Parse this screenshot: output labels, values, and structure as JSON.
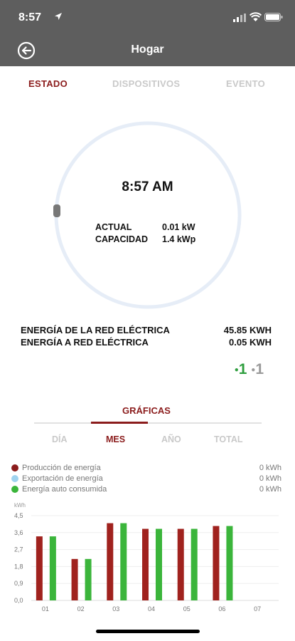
{
  "status_bar": {
    "time": "8:57"
  },
  "header": {
    "title": "Hogar"
  },
  "tabs": [
    {
      "label": "ESTADO",
      "active": true
    },
    {
      "label": "DISPOSITIVOS",
      "active": false
    },
    {
      "label": "EVENTO",
      "active": false
    }
  ],
  "gauge": {
    "time": "8:57 AM",
    "actual_label": "ACTUAL",
    "actual_value": "0.01 kW",
    "capacity_label": "CAPACIDAD",
    "capacity_value": "1.4 kWp"
  },
  "energy": {
    "from_grid_label": "ENERGÍA DE LA RED ELÉCTRICA",
    "from_grid_value": "45.85 KWH",
    "to_grid_label": "ENERGÍA A RED ELÉCTRICA",
    "to_grid_value": "0.05 KWH"
  },
  "device_counts": {
    "online": "1",
    "offline": "1"
  },
  "graphs": {
    "title": "GRÁFICAS",
    "periods": [
      {
        "label": "DÍA",
        "active": false
      },
      {
        "label": "MES",
        "active": true
      },
      {
        "label": "AÑO",
        "active": false
      },
      {
        "label": "TOTAL",
        "active": false
      }
    ],
    "legend": [
      {
        "label": "Producción de energía",
        "value": "0 kWh",
        "color": "#8b1c1c"
      },
      {
        "label": "Exportación de energía",
        "value": "0 kWh",
        "color": "#9fd3ef"
      },
      {
        "label": "Energía auto consumida",
        "value": "0 kWh",
        "color": "#3bb53b"
      }
    ]
  },
  "colors": {
    "accent": "#8b1c1c",
    "header_bg": "#5e5e5e",
    "green": "#3bb53b",
    "gauge_ring": "#e6edf7"
  },
  "chart_data": {
    "type": "bar",
    "ylabel": "kWh",
    "ylim": [
      0,
      4.5
    ],
    "yticks": [
      "0,0",
      "0,9",
      "1,8",
      "2,7",
      "3,6",
      "4,5"
    ],
    "categories": [
      "01",
      "02",
      "03",
      "04",
      "05",
      "06",
      "07"
    ],
    "grid": true,
    "series": [
      {
        "name": "Producción de energía",
        "color": "#a0221e",
        "values": [
          3.4,
          2.2,
          4.1,
          3.8,
          3.8,
          3.95,
          null
        ]
      },
      {
        "name": "Energía auto consumida",
        "color": "#3bb53b",
        "values": [
          3.4,
          2.2,
          4.1,
          3.8,
          3.8,
          3.95,
          null
        ]
      }
    ]
  }
}
